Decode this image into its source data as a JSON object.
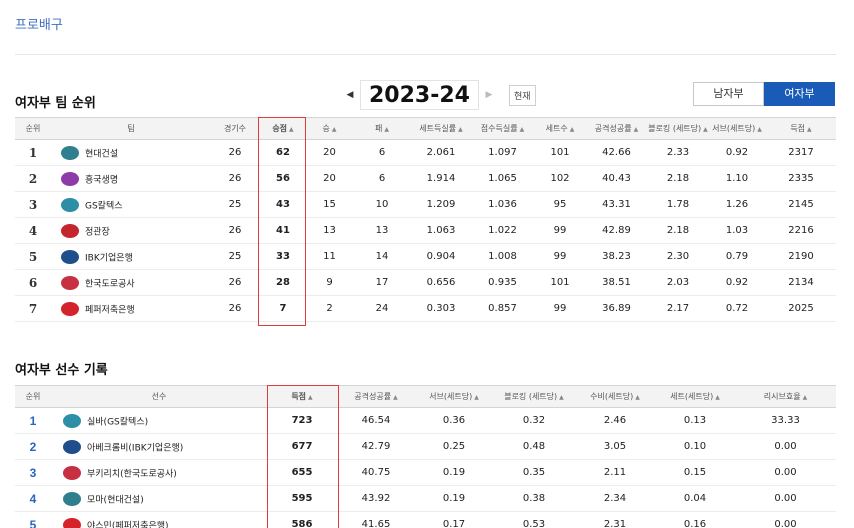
{
  "breadcrumb": "프로배구",
  "team_section": {
    "title": "여자부 팀 순위",
    "season": "2023-24",
    "current_button": "현재",
    "gender_tabs": [
      "남자부",
      "여자부"
    ],
    "headers": [
      "순위",
      "팀",
      "경기수",
      "승점",
      "승",
      "패",
      "세트득실률",
      "점수득실률",
      "세트수",
      "공격성공률",
      "블로킹 (세트당)",
      "서브(세트당)",
      "득점"
    ],
    "rows": [
      {
        "rank": "1",
        "team": "현대건설",
        "logo_color": "#2f7f8f",
        "games": "26",
        "points": "62",
        "win": "20",
        "loss": "6",
        "set_ratio": "2.061",
        "score_ratio": "1.097",
        "sets": "101",
        "attack": "42.66",
        "block": "2.33",
        "serve": "0.92",
        "score": "2317"
      },
      {
        "rank": "2",
        "team": "흥국생명",
        "logo_color": "#8e3aa8",
        "games": "26",
        "points": "56",
        "win": "20",
        "loss": "6",
        "set_ratio": "1.914",
        "score_ratio": "1.065",
        "sets": "102",
        "attack": "40.43",
        "block": "2.18",
        "serve": "1.10",
        "score": "2335"
      },
      {
        "rank": "3",
        "team": "GS칼텍스",
        "logo_color": "#2c8fa6",
        "games": "25",
        "points": "43",
        "win": "15",
        "loss": "10",
        "set_ratio": "1.209",
        "score_ratio": "1.036",
        "sets": "95",
        "attack": "43.31",
        "block": "1.78",
        "serve": "1.26",
        "score": "2145"
      },
      {
        "rank": "4",
        "team": "정관장",
        "logo_color": "#c4262e",
        "games": "26",
        "points": "41",
        "win": "13",
        "loss": "13",
        "set_ratio": "1.063",
        "score_ratio": "1.022",
        "sets": "99",
        "attack": "42.89",
        "block": "2.18",
        "serve": "1.03",
        "score": "2216"
      },
      {
        "rank": "5",
        "team": "IBK기업은행",
        "logo_color": "#1e4f8c",
        "games": "25",
        "points": "33",
        "win": "11",
        "loss": "14",
        "set_ratio": "0.904",
        "score_ratio": "1.008",
        "sets": "99",
        "attack": "38.23",
        "block": "2.30",
        "serve": "0.79",
        "score": "2190"
      },
      {
        "rank": "6",
        "team": "한국도로공사",
        "logo_color": "#c73040",
        "games": "26",
        "points": "28",
        "win": "9",
        "loss": "17",
        "set_ratio": "0.656",
        "score_ratio": "0.935",
        "sets": "101",
        "attack": "38.51",
        "block": "2.03",
        "serve": "0.92",
        "score": "2134"
      },
      {
        "rank": "7",
        "team": "페퍼저축은행",
        "logo_color": "#d4232a",
        "games": "26",
        "points": "7",
        "win": "2",
        "loss": "24",
        "set_ratio": "0.303",
        "score_ratio": "0.857",
        "sets": "99",
        "attack": "36.89",
        "block": "2.17",
        "serve": "0.72",
        "score": "2025"
      }
    ]
  },
  "player_section": {
    "title": "여자부 선수 기록",
    "headers": [
      "순위",
      "선수",
      "득점",
      "공격성공률",
      "서브(세트당)",
      "블로킹 (세트당)",
      "수비(세트당)",
      "세트(세트당)",
      "리시브효율"
    ],
    "rows": [
      {
        "rank": "1",
        "player": "실바(GS칼텍스)",
        "logo_color": "#2c8fa6",
        "score": "723",
        "attack": "46.54",
        "serve": "0.36",
        "block": "0.32",
        "defense": "2.46",
        "set": "0.13",
        "receive": "33.33"
      },
      {
        "rank": "2",
        "player": "아베크롬비(IBK기업은행)",
        "logo_color": "#1e4f8c",
        "score": "677",
        "attack": "42.79",
        "serve": "0.25",
        "block": "0.48",
        "defense": "3.05",
        "set": "0.10",
        "receive": "0.00"
      },
      {
        "rank": "3",
        "player": "부키리치(한국도로공사)",
        "logo_color": "#c73040",
        "score": "655",
        "attack": "40.75",
        "serve": "0.19",
        "block": "0.35",
        "defense": "2.11",
        "set": "0.15",
        "receive": "0.00"
      },
      {
        "rank": "4",
        "player": "모마(현대건설)",
        "logo_color": "#2f7f8f",
        "score": "595",
        "attack": "43.92",
        "serve": "0.19",
        "block": "0.38",
        "defense": "2.34",
        "set": "0.04",
        "receive": "0.00"
      },
      {
        "rank": "5",
        "player": "야스민(페퍼저축은행)",
        "logo_color": "#d4232a",
        "score": "586",
        "attack": "41.65",
        "serve": "0.17",
        "block": "0.53",
        "defense": "2.31",
        "set": "0.16",
        "receive": "0.00"
      }
    ]
  }
}
